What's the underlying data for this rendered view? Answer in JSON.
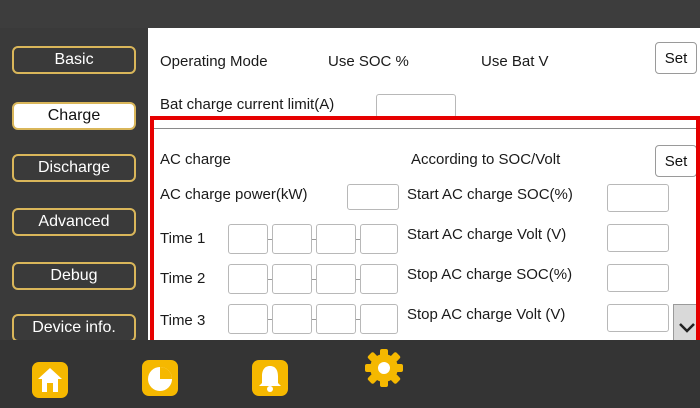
{
  "sidebar": {
    "items": [
      {
        "label": "Basic"
      },
      {
        "label": "Charge"
      },
      {
        "label": "Discharge"
      },
      {
        "label": "Advanced"
      },
      {
        "label": "Debug"
      },
      {
        "label": "Device info."
      }
    ]
  },
  "top_section": {
    "operating_mode": "Operating Mode",
    "use_soc": "Use SOC %",
    "use_bat_v": "Use Bat V",
    "set_label": "Set",
    "bat_charge_limit_label": "Bat charge current limit(A)"
  },
  "ac_section": {
    "ac_charge": "AC charge",
    "according_label": "According to SOC/Volt",
    "set_label": "Set",
    "ac_power_label": "AC charge power(kW)",
    "time1": "Time  1",
    "time2": "Time  2",
    "time3": "Time  3",
    "start_soc_label": "Start AC charge SOC(%)",
    "start_volt_label": "Start AC charge Volt (V)",
    "stop_soc_label": "Stop AC charge SOC(%)",
    "stop_volt_label": "Stop AC charge Volt (V)"
  },
  "colors": {
    "sidebar_border": "#d9b65a",
    "highlight": "#e60000",
    "icon_accent": "#f5b800"
  },
  "tabs": [
    {
      "icon": "home-icon"
    },
    {
      "icon": "pie-chart-icon"
    },
    {
      "icon": "bell-icon"
    },
    {
      "icon": "gear-icon"
    }
  ]
}
